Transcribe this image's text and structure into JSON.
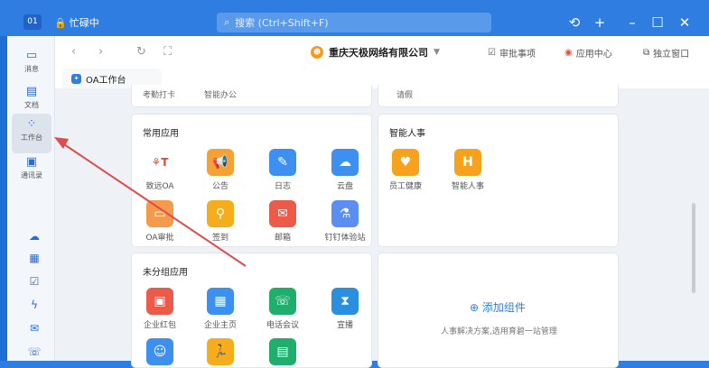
{
  "titlebar": {
    "workspace_badge": "01",
    "app_name": "忙碌中",
    "search_placeholder": "搜索 (Ctrl+Shift+F)"
  },
  "sidebar": {
    "items": [
      {
        "label": "消息",
        "icon": "message-icon"
      },
      {
        "label": "文档",
        "icon": "doc-icon"
      },
      {
        "label": "工作台",
        "icon": "workbench-icon"
      },
      {
        "label": "通讯录",
        "icon": "contacts-icon"
      }
    ],
    "extra_icons": [
      "cloud-icon",
      "calendar-icon",
      "check-icon",
      "lightning-icon",
      "mail-icon",
      "phone-icon"
    ]
  },
  "navbar": {
    "company_name": "重庆天极网络有限公司",
    "approval_label": "审批事项",
    "app_center_label": "应用中心",
    "standalone_window_label": "独立窗口"
  },
  "tab": {
    "label": "OA工作台"
  },
  "top_strip": {
    "items": [
      "考勤打卡",
      "智能办公",
      "请假"
    ]
  },
  "common_apps": {
    "title": "常用应用",
    "apps": [
      {
        "label": "致远OA",
        "color": "#ffffff"
      },
      {
        "label": "公告",
        "color": "#f5a136"
      },
      {
        "label": "日志",
        "color": "#3d8ff0"
      },
      {
        "label": "云盘",
        "color": "#3d8ff0"
      },
      {
        "label": "OA审批",
        "color": "#f39a4d"
      },
      {
        "label": "签到",
        "color": "#f6ad1c"
      },
      {
        "label": "邮箱",
        "color": "#ec5a4a"
      },
      {
        "label": "钉钉体验站",
        "color": "#5b8ef0"
      }
    ]
  },
  "smart_hr": {
    "title": "智能人事",
    "apps": [
      {
        "label": "员工健康",
        "color": "#f6a21c"
      },
      {
        "label": "智能人事",
        "color": "#f6a21c"
      }
    ]
  },
  "ungrouped": {
    "title": "未分组应用",
    "apps": [
      {
        "label": "企业红包",
        "color": "#ec5a4a"
      },
      {
        "label": "企业主页",
        "color": "#3d8ff0"
      },
      {
        "label": "电话会议",
        "color": "#1fae6b"
      },
      {
        "label": "宣播",
        "color": "#2b8fe0"
      }
    ]
  },
  "add_component": {
    "label": "添加组件",
    "description": "人事解决方案,选用育碧一站管理"
  }
}
